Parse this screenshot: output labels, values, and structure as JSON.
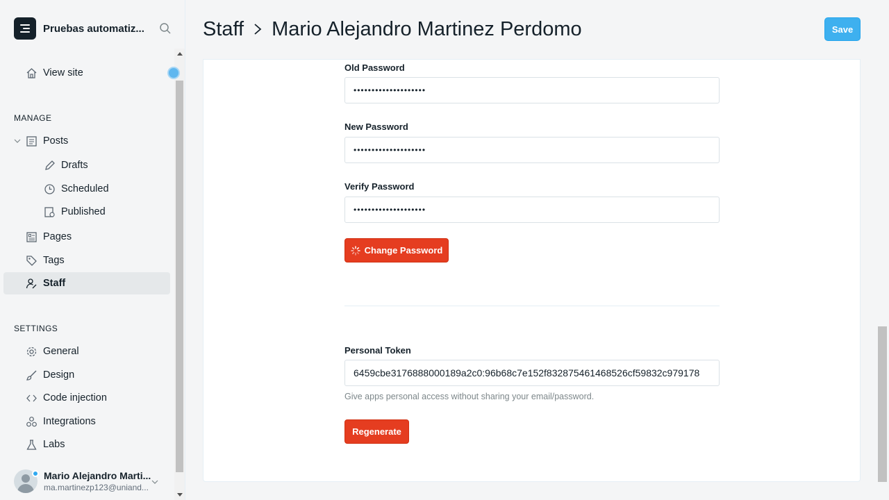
{
  "sidebar": {
    "brand_title": "Pruebas automatiz...",
    "view_site": "View site",
    "manage_title": "MANAGE",
    "settings_title": "SETTINGS",
    "items": {
      "posts": "Posts",
      "drafts": "Drafts",
      "scheduled": "Scheduled",
      "published": "Published",
      "pages": "Pages",
      "tags": "Tags",
      "staff": "Staff",
      "general": "General",
      "design": "Design",
      "code_injection": "Code injection",
      "integrations": "Integrations",
      "labs": "Labs"
    },
    "user": {
      "name": "Mario Alejandro Marti...",
      "email": "ma.martinezp123@uniand..."
    }
  },
  "header": {
    "crumb_root": "Staff",
    "crumb_current": "Mario Alejandro Martinez Perdomo",
    "save_label": "Save"
  },
  "form": {
    "old_password_label": "Old Password",
    "old_password_value": "••••••••••••••••••••",
    "new_password_label": "New Password",
    "new_password_value": "••••••••••••••••••••",
    "verify_password_label": "Verify Password",
    "verify_password_value": "••••••••••••••••••••",
    "change_password_label": "Change Password",
    "token_label": "Personal Token",
    "token_value": "6459cbe3176888000189a2c0:96b68c7e152f832875461468526cf59832c979178",
    "token_hint": "Give apps personal access without sharing your email/password.",
    "regenerate_label": "Regenerate"
  },
  "colors": {
    "accent_blue": "#3eb0ef",
    "danger_red": "#e53d20",
    "text_dark": "#15212a"
  }
}
